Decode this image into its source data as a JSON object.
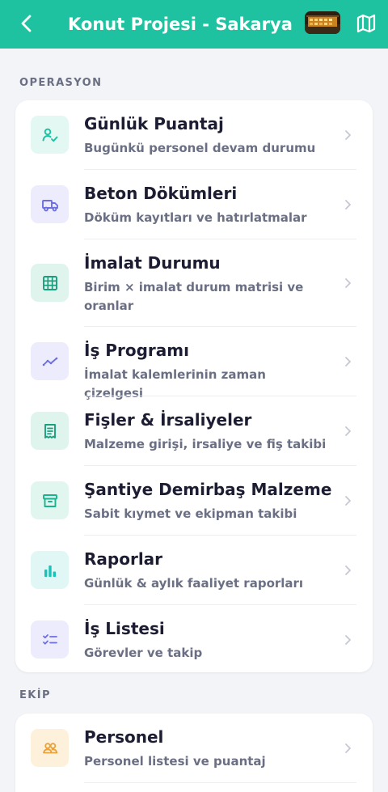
{
  "header": {
    "title": "Konut Projesi - Sakarya",
    "back_icon": "chevron-left-icon",
    "map_icon": "map-icon",
    "background": "#1fc2a0"
  },
  "sections": [
    {
      "label": "OPERASYON",
      "items": [
        {
          "title": "Günlük Puantaj",
          "subtitle": "Bugünkü personel devam durumu",
          "icon": "user-check-icon",
          "icon_color": "#19c2a2",
          "icon_bg": "#e3f8f3"
        },
        {
          "title": "Beton Dökümleri",
          "subtitle": "Döküm kayıtları ve hatırlatmalar",
          "icon": "truck-icon",
          "icon_color": "#6d6fe0",
          "icon_bg": "#ececfd"
        },
        {
          "title": "İmalat Durumu",
          "subtitle": "Birim × imalat durum matrisi ve oranlar",
          "icon": "grid-icon",
          "icon_color": "#1a9e7e",
          "icon_bg": "#e0f4ee"
        },
        {
          "title": "İş Programı",
          "subtitle": "İmalat kalemlerinin zaman çizelgesi",
          "icon": "trend-line-icon",
          "icon_color": "#6d6fe0",
          "icon_bg": "#ececfd"
        },
        {
          "title": "Fişler & İrsaliyeler",
          "subtitle": "Malzeme girişi, irsaliye ve fiş takibi",
          "icon": "receipt-icon",
          "icon_color": "#1a9e7e",
          "icon_bg": "#e0f4ee"
        },
        {
          "title": "Şantiye Demirbaş Malzeme",
          "subtitle": "Sabit kıymet ve ekipman takibi",
          "icon": "archive-box-icon",
          "icon_color": "#19b38e",
          "icon_bg": "#e0f6ef"
        },
        {
          "title": "Raporlar",
          "subtitle": "Günlük & aylık faaliyet raporları",
          "icon": "bar-chart-icon",
          "icon_color": "#19c2b6",
          "icon_bg": "#e0f7f6"
        },
        {
          "title": "İş Listesi",
          "subtitle": "Görevler ve takip",
          "icon": "checklist-icon",
          "icon_color": "#6d6fe0",
          "icon_bg": "#ececfd"
        }
      ]
    },
    {
      "label": "EKİP",
      "items": [
        {
          "title": "Personel",
          "subtitle": "Personel listesi ve puantaj",
          "icon": "users-icon",
          "icon_color": "#e8a23a",
          "icon_bg": "#fdf1dc"
        }
      ]
    }
  ]
}
